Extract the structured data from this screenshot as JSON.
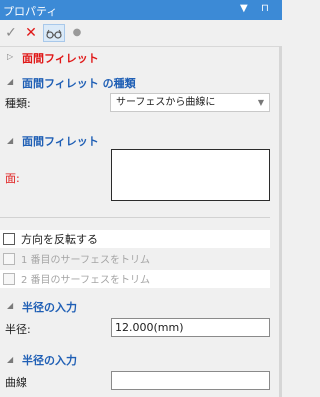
{
  "titlebar": {
    "title": "プロパティ",
    "dropdown_icon": "▼",
    "pin_icon": "⊓"
  },
  "toolbar": {
    "ok": "✓",
    "cancel": "✕",
    "preview": "👓",
    "dot": "●"
  },
  "header": {
    "title": "面間フィレット"
  },
  "section_type": {
    "title": "面間フィレット の種類",
    "label": "種類:",
    "value": "サーフェスから曲線に"
  },
  "section_faces": {
    "title": "面間フィレット",
    "label": "面:"
  },
  "options": {
    "reverse": "方向を反転する",
    "trim1": "1 番目のサーフェスをトリム",
    "trim2": "2 番目のサーフェスをトリム"
  },
  "section_radius": {
    "title": "半径の入力",
    "label": "半径:",
    "value": "12.000(mm)"
  },
  "section_radius2": {
    "title": "半径の入力",
    "label": "曲線",
    "value": ""
  },
  "colors": {
    "accent": "#3c8ad6",
    "section_title": "#1f5fb5",
    "required": "#e01818"
  }
}
